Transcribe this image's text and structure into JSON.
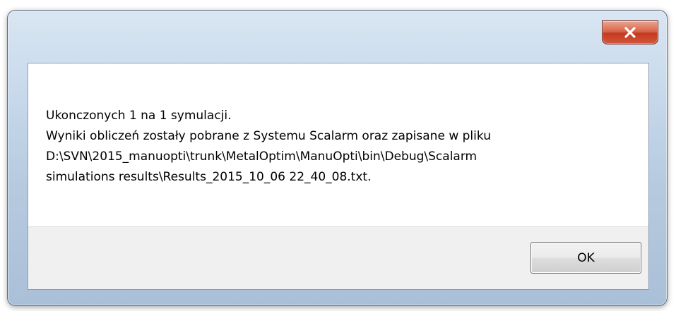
{
  "window": {
    "title": ""
  },
  "titlebar": {
    "close_icon": "close-icon"
  },
  "message": {
    "lines": [
      "Ukonczonych 1 na 1 symulacji.",
      "Wyniki obliczeń zostały pobrane z Systemu Scalarm oraz zapisane w pliku",
      "D:\\SVN\\2015_manuopti\\trunk\\MetalOptim\\ManuOpti\\bin\\Debug\\Scalarm",
      "simulations results\\Results_2015_10_06 22_40_08.txt."
    ]
  },
  "buttons": {
    "ok_label": "OK"
  },
  "colors": {
    "close_button": "#c5391e",
    "frame": "#b6cadf",
    "button_bar": "#f0f0f0"
  }
}
